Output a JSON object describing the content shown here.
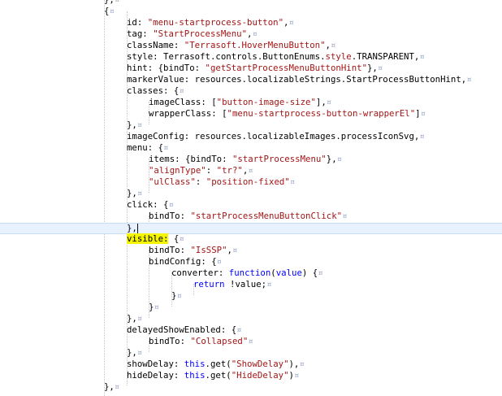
{
  "editor": {
    "lines": [
      {
        "indent": 128,
        "tokens": [
          {
            "t": "},",
            "c": "key"
          },
          {
            "t": "¤",
            "c": "mrk"
          }
        ]
      },
      {
        "indent": 128,
        "tokens": [
          {
            "t": "{",
            "c": "key"
          },
          {
            "t": "¤",
            "c": "mrk"
          }
        ]
      },
      {
        "indent": 156,
        "tokens": [
          {
            "t": "id: ",
            "c": "key"
          },
          {
            "t": "\"menu-startprocess-button\"",
            "c": "str"
          },
          {
            "t": ",",
            "c": "key"
          },
          {
            "t": "¤",
            "c": "mrk"
          }
        ]
      },
      {
        "indent": 156,
        "tokens": [
          {
            "t": "tag: ",
            "c": "key"
          },
          {
            "t": "\"StartProcessMenu\"",
            "c": "str"
          },
          {
            "t": ",",
            "c": "key"
          },
          {
            "t": "¤",
            "c": "mrk"
          }
        ]
      },
      {
        "indent": 156,
        "tokens": [
          {
            "t": "className: ",
            "c": "key"
          },
          {
            "t": "\"Terrasoft.HoverMenuButton\"",
            "c": "str"
          },
          {
            "t": ",",
            "c": "key"
          },
          {
            "t": "¤",
            "c": "mrk"
          }
        ]
      },
      {
        "indent": 156,
        "tokens": [
          {
            "t": "style: Terrasoft.controls.ButtonEnums.",
            "c": "key"
          },
          {
            "t": "style",
            "c": "str"
          },
          {
            "t": ".TRANSPARENT,",
            "c": "key"
          },
          {
            "t": "¤",
            "c": "mrk"
          }
        ]
      },
      {
        "indent": 156,
        "tokens": [
          {
            "t": "hint: {bindTo: ",
            "c": "key"
          },
          {
            "t": "\"getStartProcessMenuButtonHint\"",
            "c": "str"
          },
          {
            "t": "},",
            "c": "key"
          },
          {
            "t": "¤",
            "c": "mrk"
          }
        ]
      },
      {
        "indent": 156,
        "tokens": [
          {
            "t": "markerValue: resources.localizableStrings.StartProcessButtonHint,",
            "c": "key"
          },
          {
            "t": "¤",
            "c": "mrk"
          }
        ]
      },
      {
        "indent": 156,
        "tokens": [
          {
            "t": "classes: {",
            "c": "key"
          },
          {
            "t": "¤",
            "c": "mrk"
          }
        ]
      },
      {
        "indent": 183,
        "tokens": [
          {
            "t": "imageClass: [",
            "c": "key"
          },
          {
            "t": "\"button-image-size\"",
            "c": "str"
          },
          {
            "t": "],",
            "c": "key"
          },
          {
            "t": "¤",
            "c": "mrk"
          }
        ]
      },
      {
        "indent": 183,
        "tokens": [
          {
            "t": "wrapperClass: [",
            "c": "key"
          },
          {
            "t": "\"menu-startprocess-button-wrapperEl\"",
            "c": "str"
          },
          {
            "t": "]",
            "c": "key"
          },
          {
            "t": "¤",
            "c": "mrk"
          }
        ]
      },
      {
        "indent": 156,
        "tokens": [
          {
            "t": "},",
            "c": "key"
          },
          {
            "t": "¤",
            "c": "mrk"
          }
        ]
      },
      {
        "indent": 156,
        "tokens": [
          {
            "t": "imageConfig: resources.localizableImages.processIconSvg,",
            "c": "key"
          },
          {
            "t": "¤",
            "c": "mrk"
          }
        ]
      },
      {
        "indent": 156,
        "tokens": [
          {
            "t": "menu: {",
            "c": "key"
          },
          {
            "t": "¤",
            "c": "mrk"
          }
        ]
      },
      {
        "indent": 183,
        "tokens": [
          {
            "t": "items: {bindTo: ",
            "c": "key"
          },
          {
            "t": "\"startProcessMenu\"",
            "c": "str"
          },
          {
            "t": "},",
            "c": "key"
          },
          {
            "t": "¤",
            "c": "mrk"
          }
        ]
      },
      {
        "indent": 183,
        "tokens": [
          {
            "t": "\"alignType\"",
            "c": "str"
          },
          {
            "t": ": ",
            "c": "key"
          },
          {
            "t": "\"tr?\"",
            "c": "str"
          },
          {
            "t": ",",
            "c": "key"
          },
          {
            "t": "¤",
            "c": "mrk"
          }
        ]
      },
      {
        "indent": 183,
        "tokens": [
          {
            "t": "\"ulClass\"",
            "c": "str"
          },
          {
            "t": ": ",
            "c": "key"
          },
          {
            "t": "\"position-fixed\"",
            "c": "str"
          },
          {
            "t": "¤",
            "c": "mrk"
          }
        ]
      },
      {
        "indent": 156,
        "tokens": [
          {
            "t": "},",
            "c": "key"
          },
          {
            "t": "¤",
            "c": "mrk"
          }
        ]
      },
      {
        "indent": 156,
        "tokens": [
          {
            "t": "click: {",
            "c": "key"
          },
          {
            "t": "¤",
            "c": "mrk"
          }
        ]
      },
      {
        "indent": 183,
        "tokens": [
          {
            "t": "bindTo: ",
            "c": "key"
          },
          {
            "t": "\"startProcessMenuButtonClick\"",
            "c": "str"
          },
          {
            "t": "¤",
            "c": "mrk"
          }
        ]
      },
      {
        "indent": 156,
        "current": true,
        "tokens": [
          {
            "t": "},",
            "c": "key"
          },
          {
            "t": "",
            "c": "caret"
          }
        ]
      },
      {
        "indent": 156,
        "tokens": [
          {
            "t": "visible:",
            "c": "hl"
          },
          {
            "t": " {",
            "c": "key"
          },
          {
            "t": "¤",
            "c": "mrk"
          }
        ]
      },
      {
        "indent": 183,
        "tokens": [
          {
            "t": "bindTo: ",
            "c": "key"
          },
          {
            "t": "\"IsSSP\"",
            "c": "str"
          },
          {
            "t": ",",
            "c": "key"
          },
          {
            "t": "¤",
            "c": "mrk"
          }
        ]
      },
      {
        "indent": 183,
        "tokens": [
          {
            "t": "bindConfig: {",
            "c": "key"
          },
          {
            "t": "¤",
            "c": "mrk"
          }
        ]
      },
      {
        "indent": 211,
        "tokens": [
          {
            "t": "converter: ",
            "c": "key"
          },
          {
            "t": "function",
            "c": "kw"
          },
          {
            "t": "(",
            "c": "key"
          },
          {
            "t": "value",
            "c": "kw"
          },
          {
            "t": ") {",
            "c": "key"
          },
          {
            "t": "¤",
            "c": "mrk"
          }
        ]
      },
      {
        "indent": 238,
        "tokens": [
          {
            "t": "return",
            "c": "kw"
          },
          {
            "t": " !value;",
            "c": "key"
          },
          {
            "t": "¤",
            "c": "mrk"
          }
        ]
      },
      {
        "indent": 211,
        "tokens": [
          {
            "t": "}",
            "c": "key"
          },
          {
            "t": "¤",
            "c": "mrk"
          }
        ]
      },
      {
        "indent": 183,
        "tokens": [
          {
            "t": "}",
            "c": "key"
          },
          {
            "t": "¤",
            "c": "mrk"
          }
        ]
      },
      {
        "indent": 156,
        "tokens": [
          {
            "t": "},",
            "c": "key"
          },
          {
            "t": "¤",
            "c": "mrk"
          }
        ]
      },
      {
        "indent": 156,
        "tokens": [
          {
            "t": "delayedShowEnabled: {",
            "c": "key"
          },
          {
            "t": "¤",
            "c": "mrk"
          }
        ]
      },
      {
        "indent": 183,
        "tokens": [
          {
            "t": "bindTo: ",
            "c": "key"
          },
          {
            "t": "\"Collapsed\"",
            "c": "str"
          },
          {
            "t": "¤",
            "c": "mrk"
          }
        ]
      },
      {
        "indent": 156,
        "tokens": [
          {
            "t": "},",
            "c": "key"
          },
          {
            "t": "¤",
            "c": "mrk"
          }
        ]
      },
      {
        "indent": 156,
        "tokens": [
          {
            "t": "showDelay: ",
            "c": "key"
          },
          {
            "t": "this",
            "c": "kw"
          },
          {
            "t": ".get(",
            "c": "key"
          },
          {
            "t": "\"ShowDelay\"",
            "c": "str"
          },
          {
            "t": "),",
            "c": "key"
          },
          {
            "t": "¤",
            "c": "mrk"
          }
        ]
      },
      {
        "indent": 156,
        "tokens": [
          {
            "t": "hideDelay: ",
            "c": "key"
          },
          {
            "t": "this",
            "c": "kw"
          },
          {
            "t": ".get(",
            "c": "key"
          },
          {
            "t": "\"HideDelay\"",
            "c": "str"
          },
          {
            "t": ")",
            "c": "key"
          },
          {
            "t": "¤",
            "c": "mrk"
          }
        ]
      },
      {
        "indent": 128,
        "tokens": [
          {
            "t": "},",
            "c": "key"
          },
          {
            "t": "¤",
            "c": "mrk"
          }
        ]
      }
    ]
  }
}
